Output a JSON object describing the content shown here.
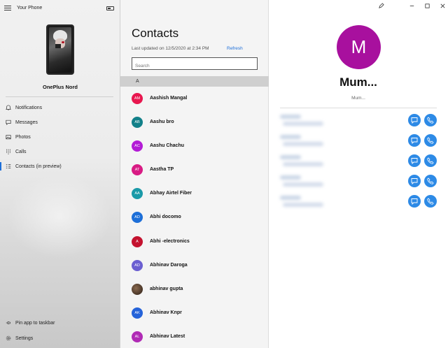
{
  "app": {
    "title": "Your Phone"
  },
  "device": {
    "name": "OnePlus Nord"
  },
  "nav": [
    {
      "label": "Notifications",
      "icon": "bell-icon"
    },
    {
      "label": "Messages",
      "icon": "message-icon"
    },
    {
      "label": "Photos",
      "icon": "photo-icon"
    },
    {
      "label": "Calls",
      "icon": "dialpad-icon"
    },
    {
      "label": "Contacts (in preview)",
      "icon": "contacts-icon",
      "active": true
    }
  ],
  "footer": [
    {
      "label": "Pin app to taskbar",
      "icon": "pin-icon"
    },
    {
      "label": "Settings",
      "icon": "gear-icon"
    }
  ],
  "contacts": {
    "title": "Contacts",
    "updated": "Last updated on 12/5/2020 at 2:34 PM",
    "refresh_label": "Refresh",
    "search_placeholder": "Search",
    "group": "A",
    "items": [
      {
        "initials": "AM",
        "name": "Aashish Mangal",
        "color": "#e8174f"
      },
      {
        "initials": "AB",
        "name": "Aashu bro",
        "color": "#128089"
      },
      {
        "initials": "AC",
        "name": "Aashu Chachu",
        "color": "#b31cd6"
      },
      {
        "initials": "AT",
        "name": "Aastha TP",
        "color": "#d81b84"
      },
      {
        "initials": "AA",
        "name": "Abhay Airtel Fiber",
        "color": "#1a9aa8"
      },
      {
        "initials": "AD",
        "name": "Abhi docomo",
        "color": "#1d6fd8"
      },
      {
        "initials": "A",
        "name": "Abhi -electronics",
        "color": "#c4122f"
      },
      {
        "initials": "AD",
        "name": "Abhinav Daroga",
        "color": "#6b5fd1"
      },
      {
        "initials": "",
        "name": "abhinav gupta",
        "color": "#3b2a20"
      },
      {
        "initials": "AK",
        "name": "Abhinav Knpr",
        "color": "#2563d9"
      },
      {
        "initials": "AL",
        "name": "Abhinav Latest",
        "color": "#b02bb5"
      }
    ]
  },
  "detail": {
    "initial": "M",
    "name": "Mum...",
    "subtitle": "Mum...",
    "avatar_color": "#a8109e",
    "accent": "#2d8ae6"
  }
}
